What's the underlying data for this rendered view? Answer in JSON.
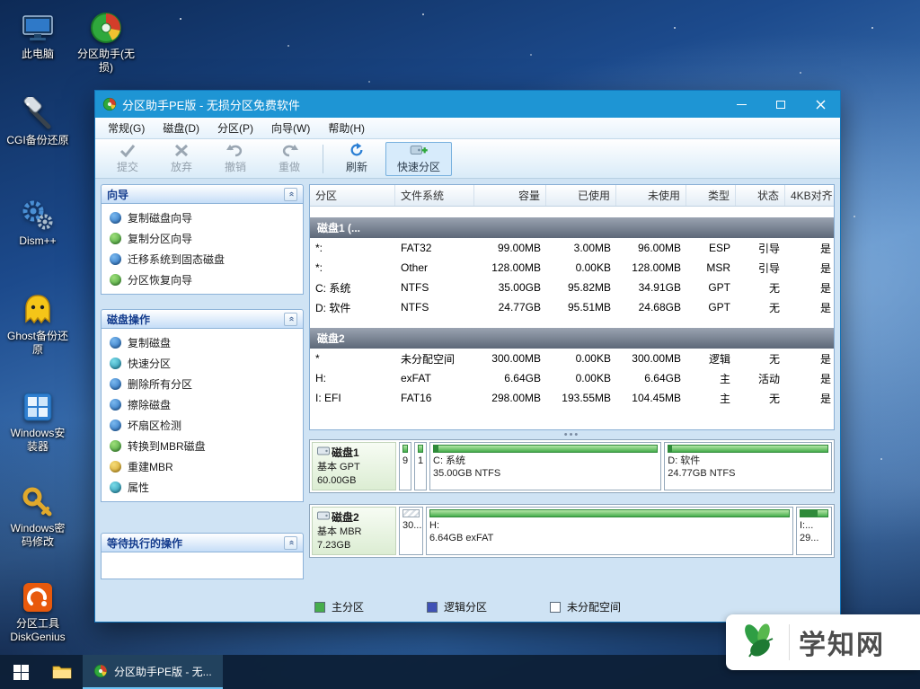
{
  "desktop": {
    "icons": [
      {
        "label": "此电脑",
        "icon": "computer-icon"
      },
      {
        "label": "分区助手(无损)",
        "icon": "partition-assistant-icon"
      },
      {
        "label": "CGI备份还原",
        "icon": "cgi-backup-icon"
      },
      {
        "label": "Dism++",
        "icon": "dism-gears-icon"
      },
      {
        "label": "Ghost备份还原",
        "icon": "ghost-icon"
      },
      {
        "label": "Windows安装器",
        "icon": "windows-installer-icon"
      },
      {
        "label": "Windows密码修改",
        "icon": "key-icon"
      },
      {
        "label": "分区工具DiskGenius",
        "icon": "diskgenius-icon"
      }
    ]
  },
  "window": {
    "title": "分区助手PE版 - 无损分区免费软件",
    "menu": {
      "general": "常规(G)",
      "disk": "磁盘(D)",
      "partition": "分区(P)",
      "wizard": "向导(W)",
      "help": "帮助(H)"
    },
    "toolbar": {
      "commit": "提交",
      "discard": "放弃",
      "undo": "撤销",
      "redo": "重做",
      "refresh": "刷新",
      "quick_partition": "快速分区"
    },
    "sidebar": {
      "wizard_title": "向导",
      "wizard_items": [
        "复制磁盘向导",
        "复制分区向导",
        "迁移系统到固态磁盘",
        "分区恢复向导"
      ],
      "disk_ops_title": "磁盘操作",
      "disk_ops_items": [
        "复制磁盘",
        "快速分区",
        "删除所有分区",
        "擦除磁盘",
        "坏扇区检测",
        "转换到MBR磁盘",
        "重建MBR",
        "属性"
      ],
      "pending_title": "等待执行的操作"
    },
    "table": {
      "columns": [
        "分区",
        "文件系统",
        "容量",
        "已使用",
        "未使用",
        "类型",
        "状态",
        "4KB对齐"
      ],
      "group1": "磁盘1 (...",
      "group1_rows": [
        [
          "*:",
          "FAT32",
          "99.00MB",
          "3.00MB",
          "96.00MB",
          "ESP",
          "引导",
          "是"
        ],
        [
          "*:",
          "Other",
          "128.00MB",
          "0.00KB",
          "128.00MB",
          "MSR",
          "引导",
          "是"
        ],
        [
          "C: 系统",
          "NTFS",
          "35.00GB",
          "95.82MB",
          "34.91GB",
          "GPT",
          "无",
          "是"
        ],
        [
          "D: 软件",
          "NTFS",
          "24.77GB",
          "95.51MB",
          "24.68GB",
          "GPT",
          "无",
          "是"
        ]
      ],
      "group2": "磁盘2",
      "group2_rows": [
        [
          "*",
          "未分配空间",
          "300.00MB",
          "0.00KB",
          "300.00MB",
          "逻辑",
          "无",
          "是"
        ],
        [
          "H:",
          "exFAT",
          "6.64GB",
          "0.00KB",
          "6.64GB",
          "主",
          "活动",
          "是"
        ],
        [
          "I: EFI",
          "FAT16",
          "298.00MB",
          "193.55MB",
          "104.45MB",
          "主",
          "无",
          "是"
        ]
      ]
    },
    "diskmap": {
      "disk1": {
        "name": "磁盘1",
        "type": "基本 GPT",
        "size": "60.00GB",
        "p1": "9",
        "p2": "1",
        "p3_l1": "C: 系统",
        "p3_l2": "35.00GB NTFS",
        "p4_l1": "D: 软件",
        "p4_l2": "24.77GB NTFS"
      },
      "disk2": {
        "name": "磁盘2",
        "type": "基本 MBR",
        "size": "7.23GB",
        "p1": "30...",
        "p2_l1": "H:",
        "p2_l2": "6.64GB exFAT",
        "p3_l1": "I:...",
        "p3_l2": "29..."
      }
    },
    "legend": {
      "primary": "主分区",
      "logical": "逻辑分区",
      "unallocated": "未分配空间"
    },
    "colors": {
      "primary_partition": "#46ad4c",
      "logical_partition": "#3f51b5",
      "unallocated": "#ffffff",
      "titlebar": "#1e95d4"
    }
  },
  "taskbar": {
    "app_button": "分区助手PE版 - 无..."
  },
  "watermark": {
    "text": "学知网"
  }
}
